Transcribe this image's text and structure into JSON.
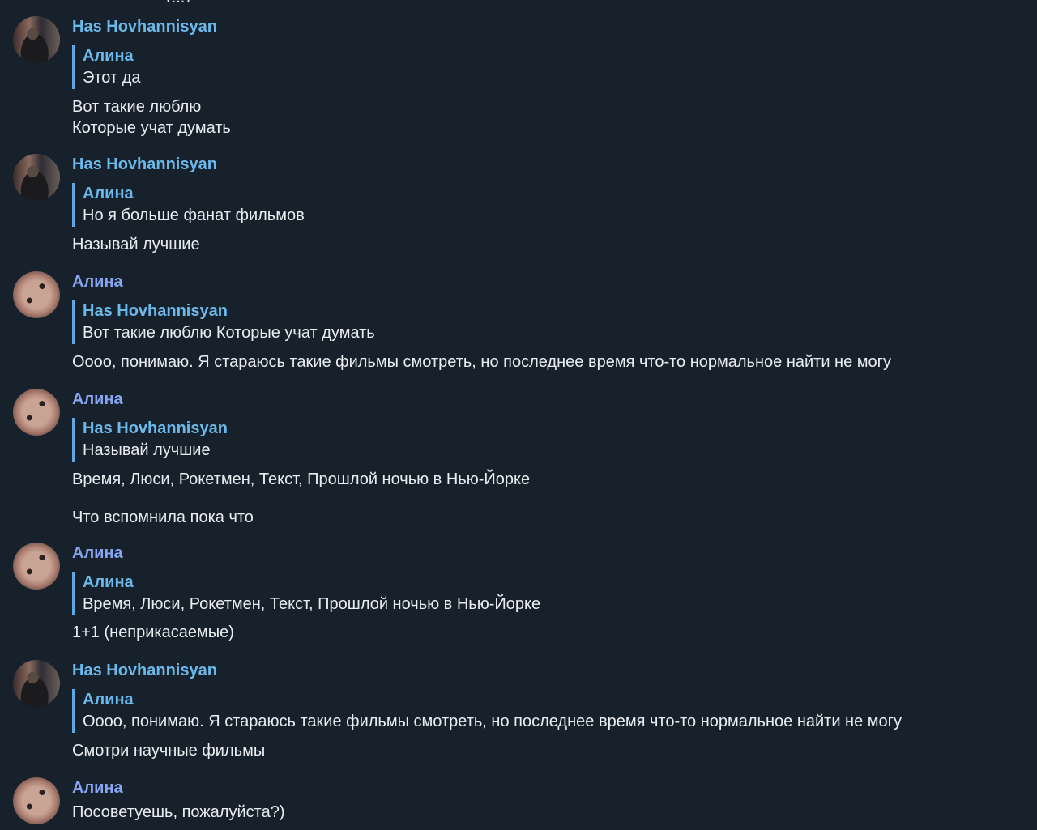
{
  "messages": [
    {
      "sender": "Has Hovhannisyan",
      "avatar": "has-avatar",
      "reply": {
        "author": "Алина",
        "text": "Этот да"
      },
      "lines": [
        "Вот такие люблю",
        "Которые учат думать"
      ]
    },
    {
      "sender": "Has Hovhannisyan",
      "avatar": "has-avatar",
      "reply": {
        "author": "Алина",
        "text": "Но я больше фанат фильмов"
      },
      "lines": [
        "Называй лучшие"
      ]
    },
    {
      "sender": "Алина",
      "avatar": "alina-avatar",
      "reply": {
        "author": "Has Hovhannisyan",
        "text": "Вот такие люблю  Которые учат думать"
      },
      "lines": [
        "Оооо, понимаю. Я стараюсь такие фильмы смотреть, но последнее время что-то нормальное найти не могу"
      ]
    },
    {
      "sender": "Алина",
      "avatar": "alina-avatar",
      "reply": {
        "author": "Has Hovhannisyan",
        "text": "Называй лучшие"
      },
      "lines": [
        "Время, Люси, Рокетмен, Текст, Прошлой ночью в Нью-Йорке",
        "Что вспомнила пока что"
      ]
    },
    {
      "sender": "Алина",
      "avatar": "alina-avatar",
      "reply": {
        "author": "Алина",
        "text": "Время, Люси, Рокетмен, Текст, Прошлой ночью в Нью-Йорке"
      },
      "lines": [
        "1+1 (неприкасаемые)"
      ]
    },
    {
      "sender": "Has Hovhannisyan",
      "avatar": "has-avatar",
      "reply": {
        "author": "Алина",
        "text": "Оооо, понимаю. Я стараюсь такие фильмы смотреть, но последнее время что-то нормальное найти не могу"
      },
      "lines": [
        "Смотри научные фильмы"
      ]
    },
    {
      "sender": "Алина",
      "avatar": "alina-avatar",
      "lines": [
        "Посоветуешь, пожалуйста?)"
      ]
    }
  ],
  "colors": {
    "background": "#17212b",
    "sender_has": "#6bb8ea",
    "sender_alina": "#88a5f2",
    "quote_bar": "#5fa8e0",
    "text": "#e9edf1"
  }
}
